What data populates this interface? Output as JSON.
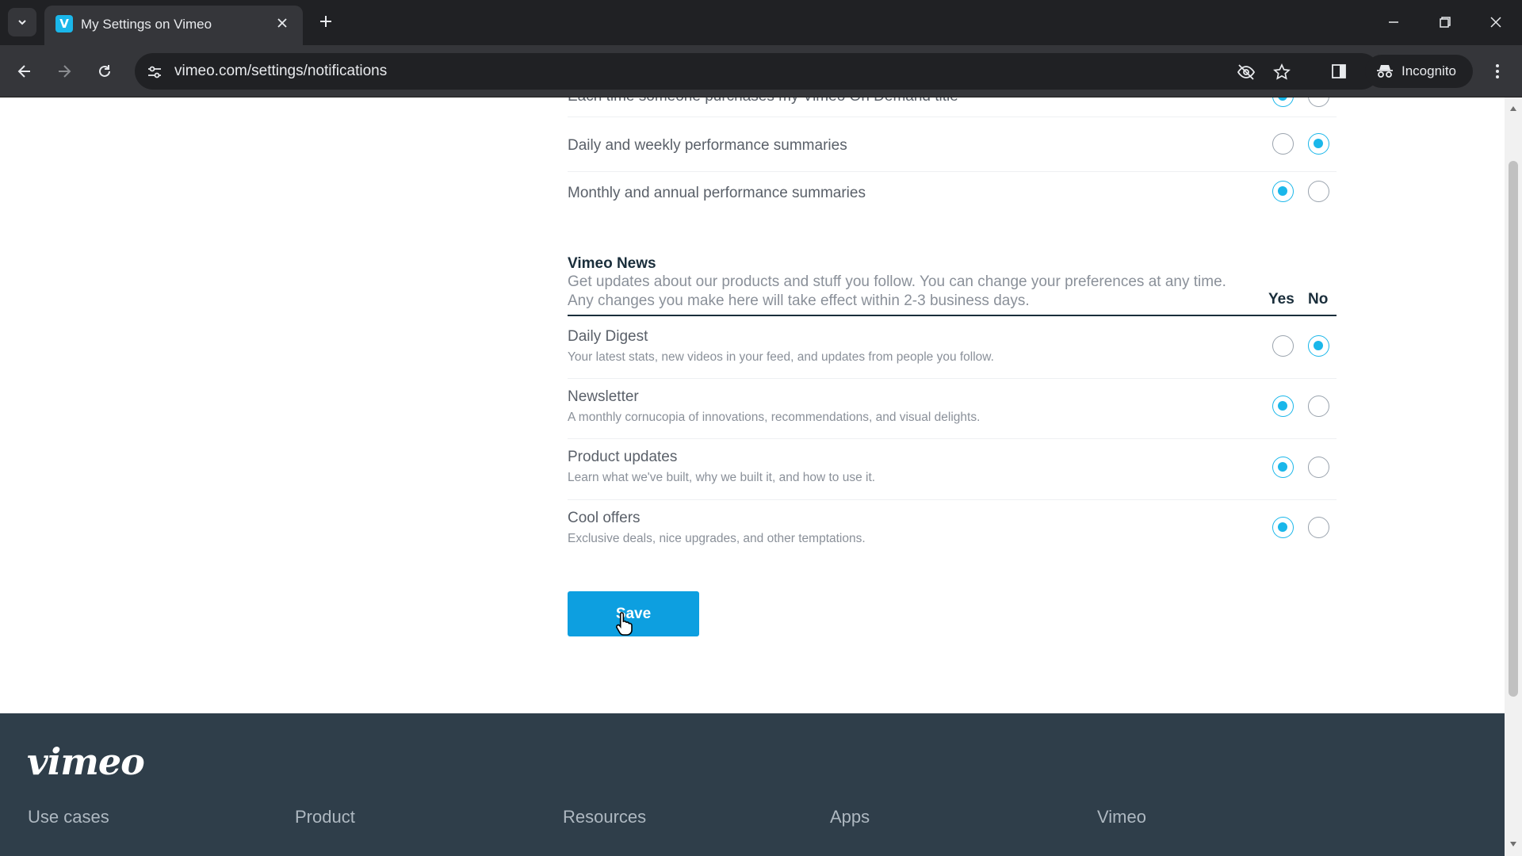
{
  "browser": {
    "tab_title": "My Settings on Vimeo",
    "url": "vimeo.com/settings/notifications",
    "incognito_label": "Incognito",
    "favicon_letter": "V"
  },
  "performance_rows": [
    {
      "title": "Each time someone purchases my Vimeo On Demand title",
      "yes": true,
      "no": false
    },
    {
      "title": "Daily and weekly performance summaries",
      "yes": false,
      "no": true
    },
    {
      "title": "Monthly and annual performance summaries",
      "yes": true,
      "no": false
    }
  ],
  "news": {
    "title": "Vimeo News",
    "description_line1": "Get updates about our products and stuff you follow. You can change your preferences at any time.",
    "description_line2": "Any changes you make here will take effect within 2-3 business days.",
    "yes_label": "Yes",
    "no_label": "No",
    "items": [
      {
        "title": "Daily Digest",
        "desc": "Your latest stats, new videos in your feed, and updates from people you follow.",
        "yes": false,
        "no": true
      },
      {
        "title": "Newsletter",
        "desc": "A monthly cornucopia of innovations, recommendations, and visual delights.",
        "yes": true,
        "no": false
      },
      {
        "title": "Product updates",
        "desc": "Learn what we've built, why we built it, and how to use it.",
        "yes": true,
        "no": false
      },
      {
        "title": "Cool offers",
        "desc": "Exclusive deals, nice upgrades, and other temptations.",
        "yes": true,
        "no": false
      }
    ]
  },
  "save_label": "Save",
  "footer": {
    "logo": "vimeo",
    "columns": [
      "Use cases",
      "Product",
      "Resources",
      "Apps",
      "Vimeo"
    ]
  },
  "colors": {
    "accent": "#1ab7ea",
    "save_button": "#0d9fe0",
    "footer_bg": "#2f3e4a"
  }
}
